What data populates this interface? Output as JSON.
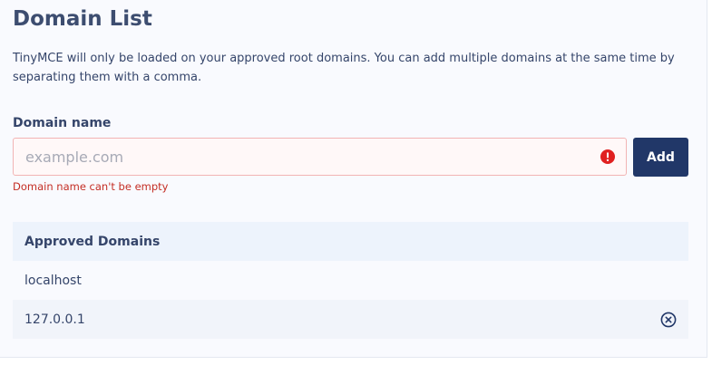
{
  "page": {
    "title": "Domain List",
    "description": "TinyMCE will only be loaded on your approved root domains. You can add multiple domains at the same time by separating them with a comma."
  },
  "form": {
    "label": "Domain name",
    "placeholder": "example.com",
    "value": "",
    "error_message": "Domain name can't be empty",
    "error_icon": "exclamation-circle-icon",
    "add_label": "Add"
  },
  "approved": {
    "header": "Approved Domains",
    "rows": [
      {
        "domain": "localhost",
        "removable": false
      },
      {
        "domain": "127.0.0.1",
        "removable": true,
        "remove_icon": "close-circle-icon"
      }
    ]
  },
  "colors": {
    "primary": "#213768",
    "title": "#3d4d70",
    "text": "#35456a",
    "error": "#c42e25",
    "error_icon": "#e02020",
    "input_error_border": "#f2b4b4",
    "header_background": "#edf3fc"
  }
}
